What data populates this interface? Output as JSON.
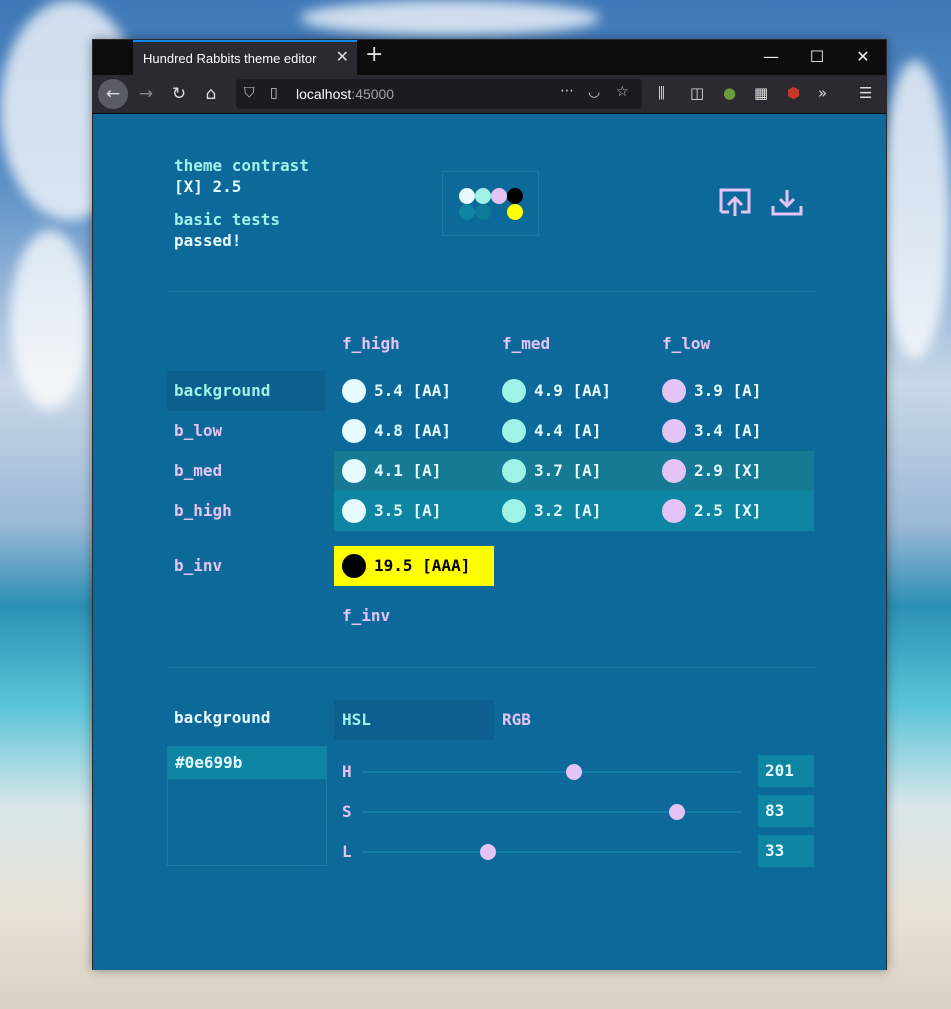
{
  "browser": {
    "tab_title": "Hundred Rabbits theme editor",
    "tab_close": "✕",
    "new_tab": "+",
    "url_host": "localhost",
    "url_port": ":45000",
    "icons": [
      "back-arrow-icon",
      "forward-arrow-icon",
      "reload-icon",
      "home-icon",
      "shield-icon",
      "page-icon",
      "more-dots-icon",
      "pocket-icon",
      "star-icon",
      "library-icon",
      "sidebar-icon",
      "extension-icon",
      "grid-icon",
      "ublock-icon",
      "overflow-icon",
      "menu-icon"
    ]
  },
  "header": {
    "contrast_label": "theme contrast",
    "contrast_value": "[X] 2.5",
    "tests_label": "basic tests",
    "tests_value": "passed!",
    "upload_icon": "upload-icon",
    "download_icon": "download-icon"
  },
  "preview_colors": {
    "top": [
      "#e5fbff",
      "#9ff2e6",
      "#e3c4f5",
      "#000000"
    ],
    "bottom": [
      "#0d85a3",
      "#0c7b9a",
      "#0e699b",
      "#ffff00"
    ]
  },
  "columns": [
    "f_high",
    "f_med",
    "f_low"
  ],
  "column_colors": [
    "#e5fbff",
    "#9ff2e6",
    "#e3c4f5"
  ],
  "rows": [
    {
      "label": "background",
      "band": "#0e699b",
      "cells": [
        "5.4 [AA]",
        "4.9 [AA]",
        "3.9 [A]"
      ]
    },
    {
      "label": "b_low",
      "band": "#0c6a9a",
      "cells": [
        "4.8 [AA]",
        "4.4 [A]",
        "3.4 [A]"
      ]
    },
    {
      "label": "b_med",
      "band": "#177a94",
      "cells": [
        "4.1 [A]",
        "3.7 [A]",
        "2.9 [X]"
      ]
    },
    {
      "label": "b_high",
      "band": "#0d85a3",
      "cells": [
        "3.5 [A]",
        "3.2 [A]",
        "2.5 [X]"
      ]
    }
  ],
  "inverse": {
    "label": "b_inv",
    "value": "19.5 [AAA]",
    "f_label": "f_inv",
    "bg": "#ffff00"
  },
  "editor": {
    "selected_name": "background",
    "hex": "#0e699b",
    "modes": [
      "HSL",
      "RGB"
    ],
    "active_mode": "HSL",
    "sliders": [
      {
        "label": "H",
        "value": "201",
        "fraction": 0.558
      },
      {
        "label": "S",
        "value": "83",
        "fraction": 0.83
      },
      {
        "label": "L",
        "value": "33",
        "fraction": 0.33
      }
    ]
  }
}
